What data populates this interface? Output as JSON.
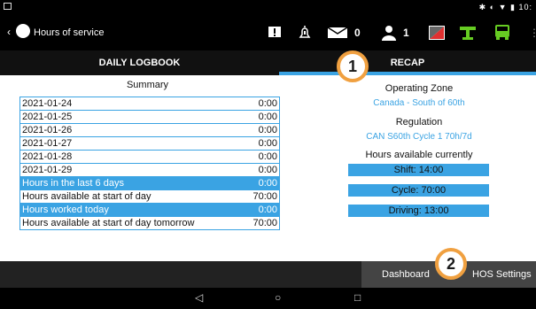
{
  "status_bar": {
    "time": "10:"
  },
  "app_bar": {
    "title": "Hours of service",
    "messages_count": "0",
    "users_count": "1"
  },
  "tabs": [
    {
      "label": "DAILY LOGBOOK",
      "selected": false
    },
    {
      "label": "RECAP",
      "selected": true
    }
  ],
  "summary": {
    "title": "Summary",
    "rows": [
      {
        "label": "2021-01-24",
        "value": "0:00",
        "highlight": false
      },
      {
        "label": "2021-01-25",
        "value": "0:00",
        "highlight": false
      },
      {
        "label": "2021-01-26",
        "value": "0:00",
        "highlight": false
      },
      {
        "label": "2021-01-27",
        "value": "0:00",
        "highlight": false
      },
      {
        "label": "2021-01-28",
        "value": "0:00",
        "highlight": false
      },
      {
        "label": "2021-01-29",
        "value": "0:00",
        "highlight": false
      },
      {
        "label": "Hours in the last 6 days",
        "value": "0:00",
        "highlight": true
      },
      {
        "label": "Hours available at start of day",
        "value": "70:00",
        "highlight": false
      },
      {
        "label": "Hours worked today",
        "value": "0:00",
        "highlight": true
      },
      {
        "label": "Hours available at start of day tomorrow",
        "value": "70:00",
        "highlight": false
      }
    ]
  },
  "recap": {
    "operating_zone_label": "Operating Zone",
    "operating_zone_value": "Canada - South of 60th",
    "regulation_label": "Regulation",
    "regulation_value": "CAN S60th Cycle 1 70h/7d",
    "hours_available_label": "Hours available currently",
    "shift": "Shift: 14:00",
    "cycle": "Cycle: 70:00",
    "driving": "Driving: 13:00"
  },
  "bottom_nav": {
    "dashboard": "Dashboard",
    "hos_settings": "HOS Settings"
  },
  "annotations": {
    "badge1": "1",
    "badge2": "2"
  },
  "colors": {
    "accent": "#3aa3e3",
    "badge_border": "#f0a040"
  }
}
